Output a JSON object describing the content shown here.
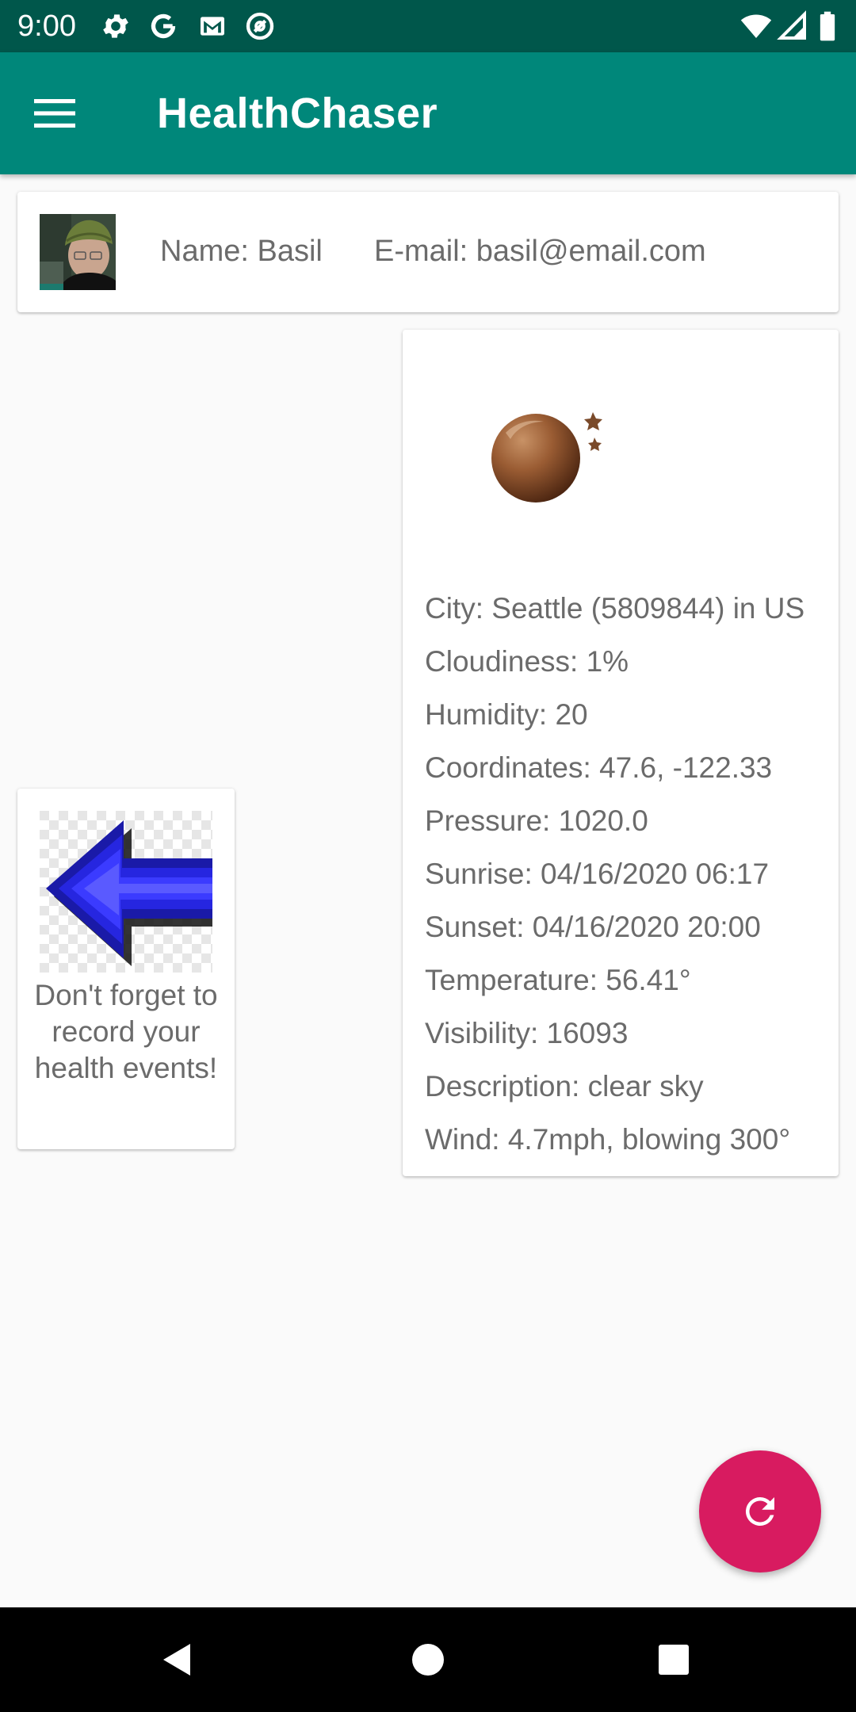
{
  "status_bar": {
    "time": "9:00",
    "left_icons": [
      "gear-icon",
      "google-icon",
      "gmail-icon",
      "at-sign-icon"
    ],
    "right_icons": [
      "wifi-icon",
      "signal-icon",
      "battery-icon"
    ]
  },
  "app_bar": {
    "menu_icon": "hamburger-menu-icon",
    "title": "HealthChaser"
  },
  "profile": {
    "avatar": "user-avatar",
    "name": "Name:  Basil",
    "email": "E-mail:  basil@email.com"
  },
  "weather": {
    "icon": "clear-night-moon-icon",
    "lines": [
      "City: Seattle (5809844) in US",
      "Cloudiness: 1%",
      "Humidity: 20",
      "Coordinates: 47.6, -122.33",
      "Pressure: 1020.0",
      "Sunrise: 04/16/2020 06:17",
      "Sunset: 04/16/2020 20:00",
      "Temperature: 56.41°",
      "Visibility: 16093",
      "Description: clear sky",
      "Wind: 4.7mph, blowing 300°"
    ]
  },
  "reminder": {
    "image": "blue-left-arrow",
    "text": "Don't forget to record your health events!"
  },
  "fab": {
    "icon": "refresh-icon"
  },
  "nav_bar": {
    "buttons": [
      "back-icon",
      "home-icon",
      "recents-icon"
    ]
  },
  "colors": {
    "status_bar": "#00574b",
    "app_bar": "#00877a",
    "fab": "#d81b60",
    "background": "#fafafa",
    "text": "#6b6b6b"
  }
}
